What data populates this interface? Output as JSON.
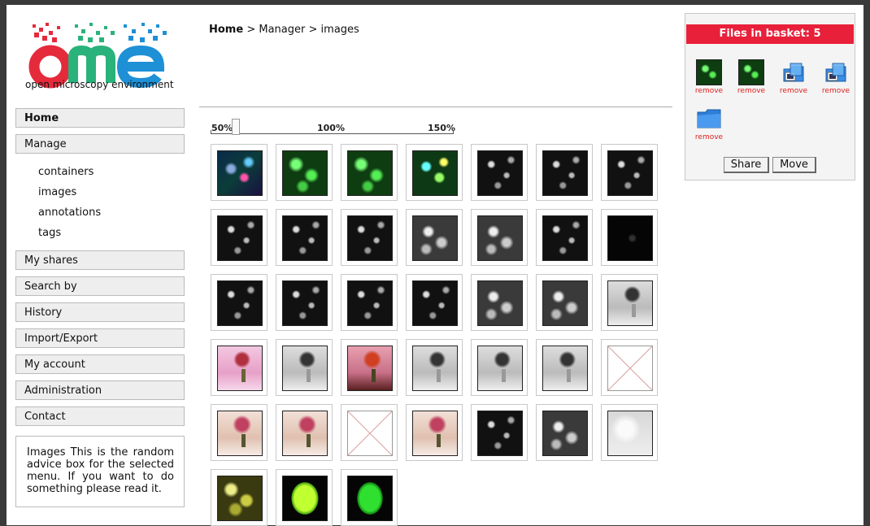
{
  "logo": {
    "caption": "open microscopy environment",
    "brand_colors": [
      "#e52a3c",
      "#2ab27b",
      "#1e90d6"
    ]
  },
  "breadcrumb": {
    "home": "Home",
    "sep1": ">",
    "manager": "Manager",
    "sep2": ">",
    "current": "images"
  },
  "sidebar": {
    "home": "Home",
    "manage": "Manage",
    "sub_items": [
      "containers",
      "images",
      "annotations",
      "tags"
    ],
    "items": [
      "My shares",
      "Search by",
      "History",
      "Import/Export",
      "My account",
      "Administration",
      "Contact"
    ]
  },
  "advice": {
    "text": "Images This is the random advice box for the selected menu. If you want to do something please read it."
  },
  "zoom": {
    "labels": [
      "50%",
      "100%",
      "150%"
    ],
    "value_percent": 60
  },
  "thumbnails": {
    "row1": [
      "fluor-rgb",
      "fluor-green",
      "fluor-green",
      "fluor-green-cyan",
      "gray-dark",
      "gray-dark",
      "gray-dark"
    ],
    "row2": [
      "gray-dark",
      "gray-dark",
      "gray-dark",
      "gray-mid",
      "gray-mid",
      "gray-dark",
      "black"
    ],
    "row3": [
      "gray-dark",
      "gray-dark",
      "gray-dark",
      "gray-dark",
      "gray-mid",
      "gray-mid",
      "flower-bw"
    ],
    "row4": [
      "flower-pink",
      "flower-bw",
      "flower-red",
      "flower-bw",
      "flower-bw",
      "flower-bw",
      "missing"
    ],
    "row5": [
      "flower-color",
      "flower-color",
      "missing",
      "flower-color",
      "gray-dark",
      "gray-mid",
      "gray-light"
    ],
    "row6": [
      "yellow-cells",
      "green-blob-red",
      "green-blob"
    ]
  },
  "basket": {
    "title": "Files in basket: 5",
    "items": [
      {
        "type": "image-green",
        "remove": "remove"
      },
      {
        "type": "image-green",
        "remove": "remove"
      },
      {
        "type": "dataset-folder-icon",
        "remove": "remove"
      },
      {
        "type": "dataset-folder-icon",
        "remove": "remove"
      },
      {
        "type": "folder-icon",
        "remove": "remove"
      }
    ],
    "share_label": "Share",
    "move_label": "Move"
  }
}
